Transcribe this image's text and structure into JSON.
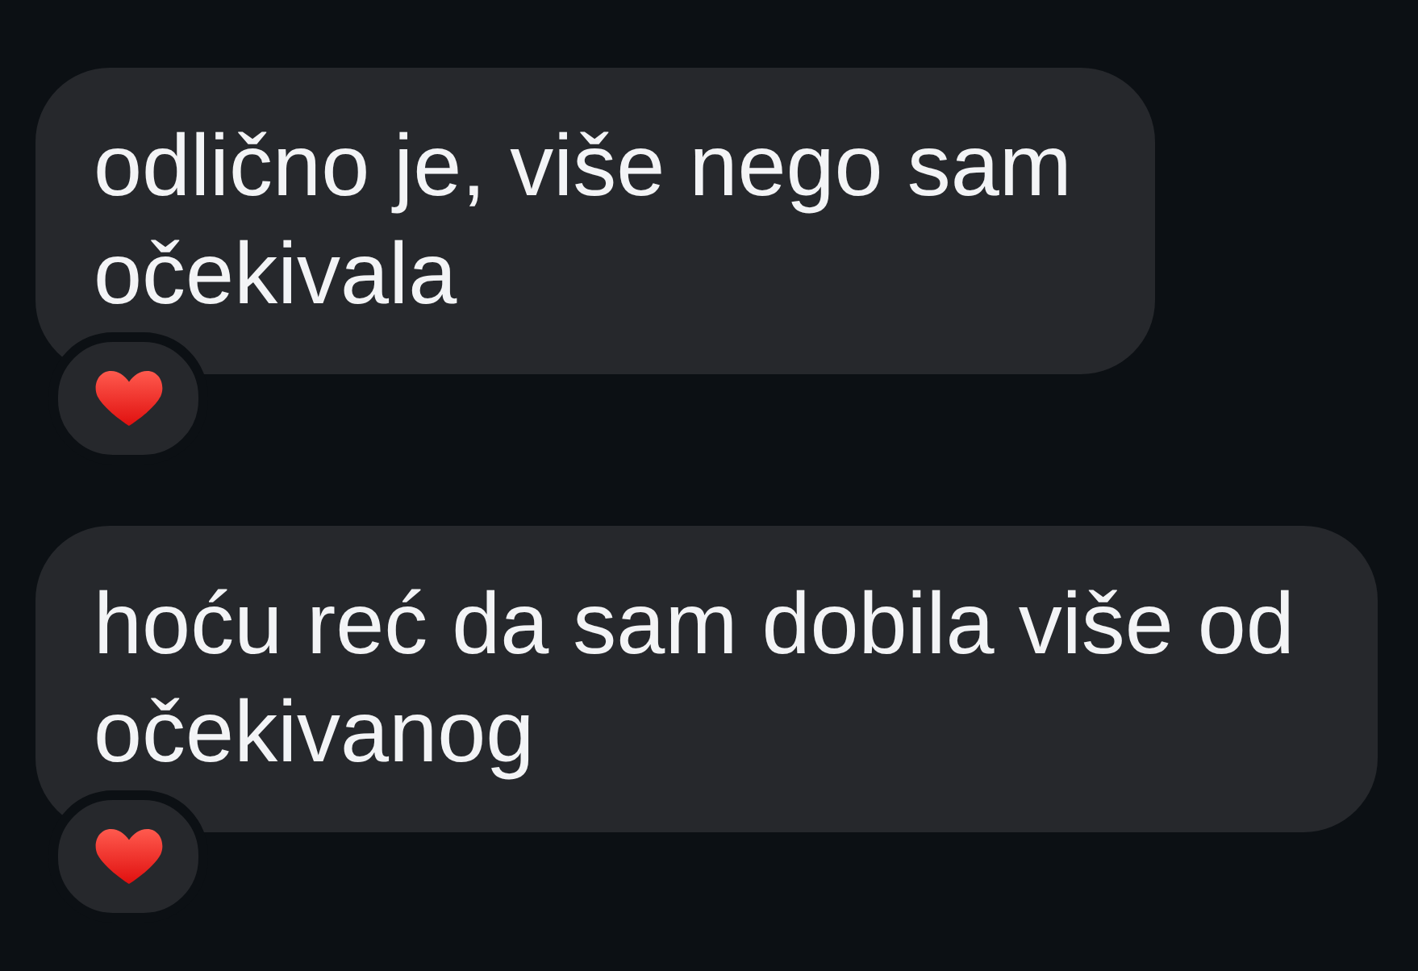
{
  "messages": [
    {
      "text": "odlično je, više nego sam očekivala",
      "reactions": [
        {
          "kind": "heart"
        }
      ]
    },
    {
      "text": "hoću reć da sam dobila više od očekivanog",
      "reactions": [
        {
          "kind": "heart"
        }
      ]
    }
  ]
}
